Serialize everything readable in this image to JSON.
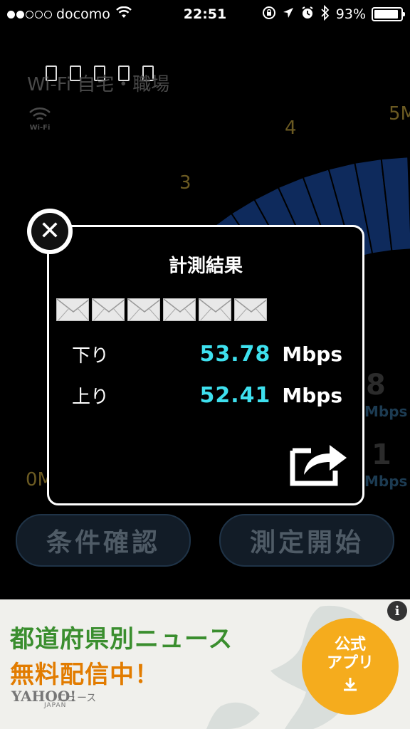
{
  "status_bar": {
    "carrier": "docomo",
    "time": "22:51",
    "battery": "93%",
    "battery_level": 0.93,
    "signal_strength_dots": 2
  },
  "background": {
    "network_title": "Wi-Fi 自宅・職場",
    "wifi_label": "Wi-Fi",
    "gauge_labels": [
      "0M",
      "3",
      "4",
      "5M"
    ],
    "speed_partial_1": "8",
    "unit_partial_1": "Mbps",
    "speed_partial_2": "1",
    "unit_partial_2": "Mbps",
    "button_conditions": "条件確認",
    "button_start": "測定開始"
  },
  "dialog": {
    "title": "計測結果",
    "mail_icons": [
      "envelope-icon",
      "envelope-icon",
      "envelope-icon",
      "envelope-icon",
      "envelope-icon",
      "envelope-icon"
    ],
    "download_label": "下り",
    "download_value": "53.78",
    "download_unit": "Mbps",
    "upload_label": "上り",
    "upload_value": "52.41",
    "upload_unit": "Mbps",
    "close_glyph": "✕"
  },
  "ad": {
    "line1": "都道府県別ニュース",
    "line2": "無料配信中！",
    "logo": "YAHOO!",
    "logo_japan": "JAPAN",
    "logo_sub": "ニュース",
    "cta_line1": "公式",
    "cta_line2": "アプリ",
    "info_glyph": "i",
    "colors": {
      "green": "#3a8e2e",
      "orange": "#e27c00",
      "cta": "#f5ac1d"
    }
  },
  "colors": {
    "speed_value": "#3ee0ee",
    "gauge_blue": "#0e2a5c"
  }
}
